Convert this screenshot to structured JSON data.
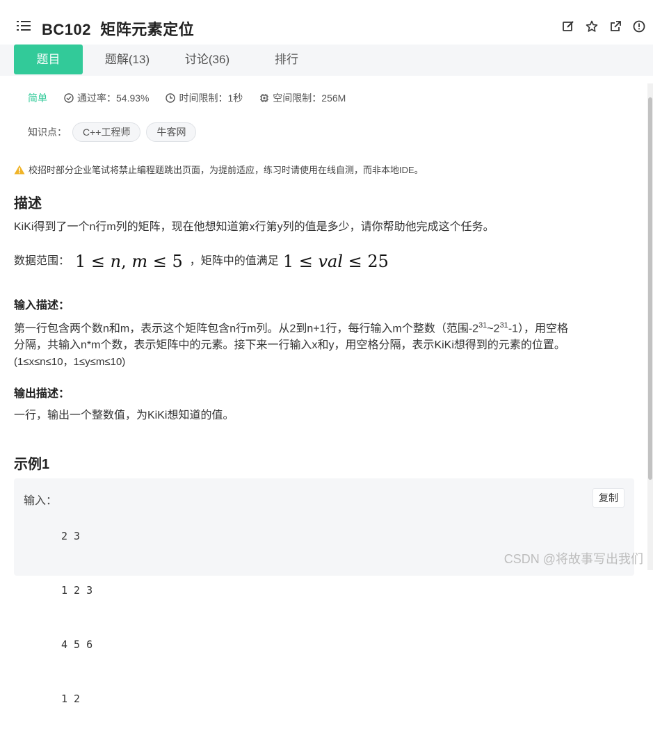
{
  "header": {
    "title": "BC102  矩阵元素定位",
    "icons": [
      "menu-icon",
      "edit-icon",
      "star-icon",
      "external-link-icon",
      "info-icon"
    ]
  },
  "tabs": [
    {
      "label": "题目",
      "active": true
    },
    {
      "label": "题解(13)",
      "active": false
    },
    {
      "label": "讨论(36)",
      "active": false
    },
    {
      "label": "排行",
      "active": false
    }
  ],
  "meta": {
    "difficulty": "简单",
    "pass_rate": "通过率：54.93%",
    "time_limit": "时间限制：1秒",
    "space_limit": "空间限制：256M"
  },
  "knowledge": {
    "label": "知识点：",
    "tags": [
      "C++工程师",
      "牛客网"
    ]
  },
  "warning": "校招时部分企业笔试将禁止编程题跳出页面，为提前适应，练习时请使用在线自测，而非本地IDE。",
  "description": {
    "heading": "描述",
    "text": "KiKi得到了一个n行m列的矩阵，现在他想知道第x行第y列的值是多少，请你帮助他完成这个任务。",
    "range_prefix": "数据范围：",
    "range_mid": "，矩阵中的值满足",
    "math1": "1 ≤ n, m ≤ 5",
    "math2": "1 ≤ val ≤ 25"
  },
  "input_desc": {
    "heading": "输入描述：",
    "line1_a": "第一行包含两个数n和m，表示这个矩阵包含n行m列。从2到n+1行，每行输入m个整数（范围-2",
    "sup1": "31",
    "line1_b": "~2",
    "sup2": "31",
    "line1_c": "-1），用空格",
    "line2": "分隔，共输入n*m个数，表示矩阵中的元素。接下来一行输入x和y，用空格分隔，表示KiKi想得到的元素的位置。",
    "line3": "(1≤x≤n≤10，1≤y≤m≤10)"
  },
  "output_desc": {
    "heading": "输出描述：",
    "text": "一行，输出一个整数值，为KiKi想知道的值。"
  },
  "example": {
    "heading": "示例1",
    "input_label": "输入：",
    "lines": [
      "2 3",
      "1 2 3",
      "4 5 6",
      "1 2"
    ],
    "copy_label": "复制"
  },
  "watermark": "CSDN @将故事写出我们"
}
